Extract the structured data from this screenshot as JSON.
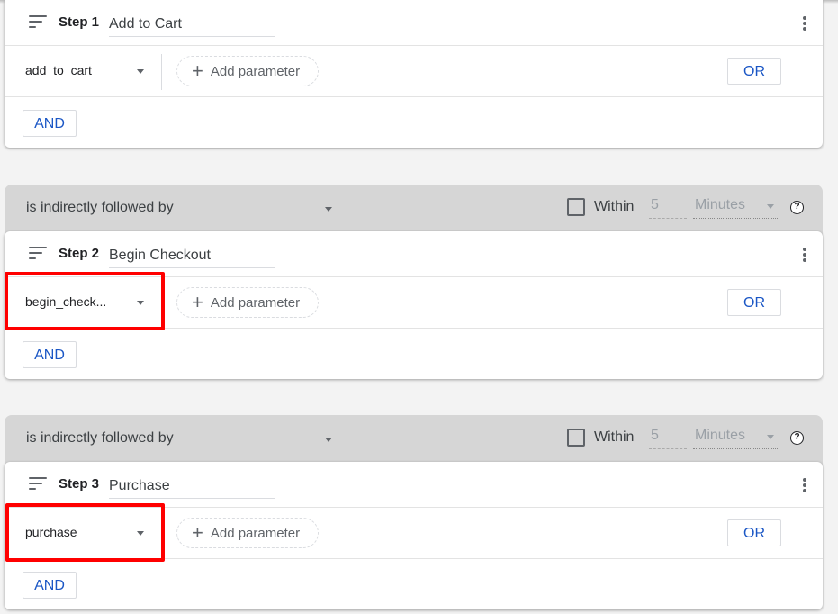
{
  "steps": [
    {
      "label": "Step 1",
      "name": "Add to Cart",
      "event": "add_to_cart",
      "add_parameter_label": "Add parameter",
      "or_label": "OR",
      "and_label": "AND"
    },
    {
      "label": "Step 2",
      "name": "Begin Checkout",
      "event": "begin_check...",
      "add_parameter_label": "Add parameter",
      "or_label": "OR",
      "and_label": "AND",
      "highlighted": true
    },
    {
      "label": "Step 3",
      "name": "Purchase",
      "event": "purchase",
      "add_parameter_label": "Add parameter",
      "or_label": "OR",
      "and_label": "AND",
      "highlighted": true
    }
  ],
  "sequences": [
    {
      "relation": "is indirectly followed by",
      "within_label": "Within",
      "within_checked": false,
      "within_value": "5",
      "within_unit": "Minutes",
      "help": "?"
    },
    {
      "relation": "is indirectly followed by",
      "within_label": "Within",
      "within_checked": false,
      "within_value": "5",
      "within_unit": "Minutes",
      "help": "?"
    }
  ],
  "icons": {
    "plus": "+",
    "sort": "sort-icon",
    "more": "more-vert-icon",
    "dropdown": "arrow-drop-down-icon",
    "help": "help-icon"
  },
  "colors": {
    "accent": "#1a56c5",
    "highlight": "#ff0000",
    "sequence_bar": "#d6d6d6",
    "background": "#f3f3f3"
  }
}
